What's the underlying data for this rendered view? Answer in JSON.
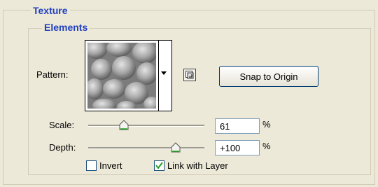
{
  "section_title": "Texture",
  "group_title": "Elements",
  "pattern": {
    "label": "Pattern:"
  },
  "snap_button": {
    "label": "Snap to Origin"
  },
  "scale": {
    "label": "Scale:",
    "value": "61",
    "unit": "%",
    "level": 0.25
  },
  "depth": {
    "label": "Depth:",
    "value": "+100",
    "unit": "%",
    "level": 0.75
  },
  "invert": {
    "label": "Invert",
    "checked": false
  },
  "link_layer": {
    "label": "Link with Layer",
    "checked": true
  },
  "icons": [
    "dropdown-arrow-icon",
    "new-preset-icon",
    "slider-thumb-icon",
    "checkmark-icon"
  ]
}
